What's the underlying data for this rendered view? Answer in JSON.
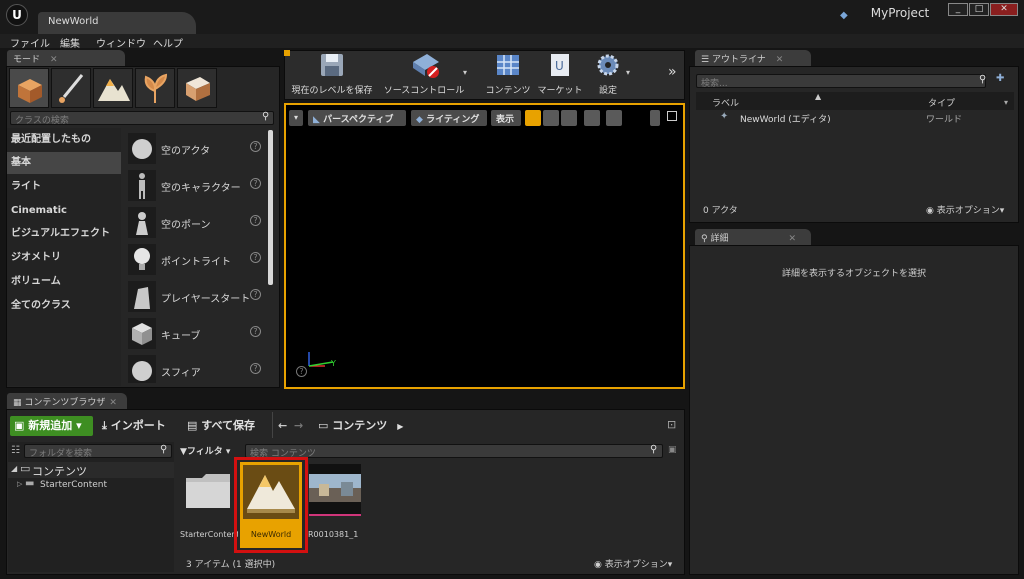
{
  "window": {
    "document_tab": "NewWorld",
    "project_name": "MyProject",
    "buttons": [
      "_",
      "□",
      "✕"
    ]
  },
  "menu": [
    "ファイル",
    "編集",
    "ウィンドウ",
    "ヘルプ"
  ],
  "modes": {
    "tab_label": "モード",
    "search_placeholder": "クラスの検索",
    "categories": [
      "最近配置したもの",
      "基本",
      "ライト",
      "Cinematic",
      "ビジュアルエフェクト",
      "ジオメトリ",
      "ボリューム",
      "全てのクラス"
    ],
    "active_category": "基本",
    "items": [
      "空のアクタ",
      "空のキャラクター",
      "空のポーン",
      "ポイントライト",
      "プレイヤースタート",
      "キューブ",
      "スフィア"
    ]
  },
  "toolbar": {
    "save_level": "現在のレベルを保存",
    "source_control": "ソースコントロール",
    "content": "コンテンツ",
    "marketplace": "マーケット",
    "settings": "設定"
  },
  "viewport": {
    "perspective": "パースペクティブ",
    "lighting": "ライティング",
    "show": "表示"
  },
  "outliner": {
    "tab_label": "アウトライナ",
    "search_placeholder": "検索...",
    "col_label": "ラベル",
    "col_type": "タイプ",
    "row_label": "NewWorld (エディタ)",
    "row_type": "ワールド",
    "actor_count": "0 アクタ",
    "view_options": "表示オプション"
  },
  "details": {
    "tab_label": "詳細",
    "message": "詳細を表示するオブジェクトを選択"
  },
  "content_browser": {
    "tab_label": "コンテンツブラウザ",
    "add_new": "新規追加",
    "import": "インポート",
    "save_all": "すべて保存",
    "path": "コンテンツ",
    "folder_search": "フォルダを検索",
    "tree_root": "コンテンツ",
    "tree_child": "StarterContent",
    "filter": "フィルタ",
    "search_placeholder": "検索 コンテンツ",
    "assets": [
      "StarterContent",
      "NewWorld",
      "R0010381_1"
    ],
    "status": "3 アイテム (1 選択中)",
    "view_options": "表示オプション"
  },
  "colors": {
    "accent_orange": "#e8a200",
    "selection_red": "#d31010",
    "add_new_green": "#3e8e22"
  }
}
